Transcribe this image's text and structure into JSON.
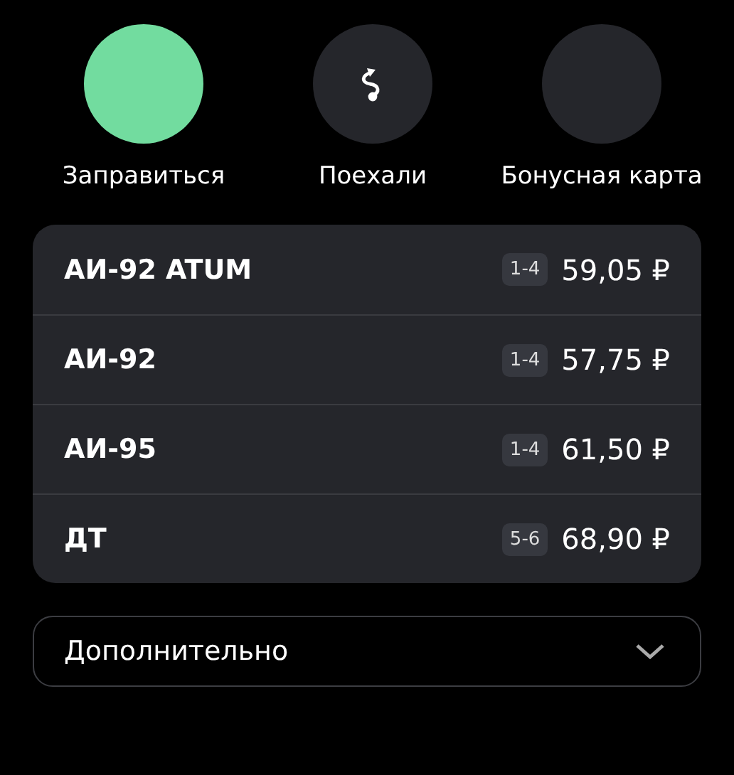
{
  "actions": [
    {
      "label": "Заправиться",
      "color": "#72dc9f",
      "kind": "plain"
    },
    {
      "label": "Поехали",
      "color": "#25262b",
      "kind": "route"
    },
    {
      "label": "Бонусная карта",
      "color": "#25262b",
      "kind": "plain"
    }
  ],
  "fuels": [
    {
      "name": "АИ-92 ATUM",
      "pumps": "1-4",
      "price": "59,05 ₽"
    },
    {
      "name": "АИ-92",
      "pumps": "1-4",
      "price": "57,75 ₽"
    },
    {
      "name": "АИ-95",
      "pumps": "1-4",
      "price": "61,50 ₽"
    },
    {
      "name": "ДТ",
      "pumps": "5-6",
      "price": "68,90 ₽"
    }
  ],
  "more": {
    "label": "Дополнительно",
    "expanded": false
  }
}
